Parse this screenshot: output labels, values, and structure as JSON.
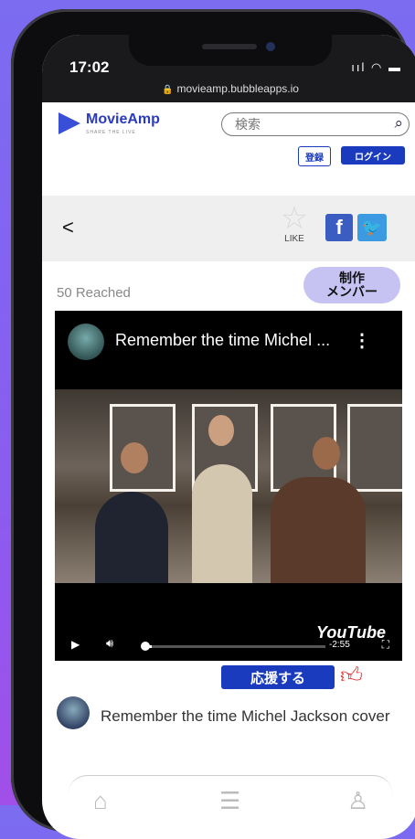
{
  "status": {
    "time": "17:02",
    "signal": "ııl",
    "wifi": "wifi",
    "battery": "battery"
  },
  "browser": {
    "url": "movieamp.bubbleapps.io"
  },
  "header": {
    "logo_text": "MovieAmp",
    "logo_tagline": "SHARE THE LIVE",
    "search_placeholder": "検索",
    "register_label": "登録",
    "login_label": "ログイン"
  },
  "actions": {
    "back": "<",
    "like_label": "LIKE",
    "facebook": "f",
    "twitter": "🐦"
  },
  "reach": {
    "text": "50 Reached"
  },
  "members_button": {
    "label": "制作\nメンバー"
  },
  "video": {
    "title": "Remember the time Michel ...",
    "menu": "⋮",
    "platform": "YouTube",
    "duration": "-2:55",
    "progress": 0.05
  },
  "support_button": {
    "label": "応援する"
  },
  "post": {
    "title": "Remember the time Michel Jackson cover"
  },
  "tabs": [
    {
      "name": "home-icon",
      "glyph": "⌂"
    },
    {
      "name": "list-icon",
      "glyph": "☰"
    },
    {
      "name": "user-icon",
      "glyph": "♙"
    }
  ],
  "colors": {
    "brand": "#1a3bbd",
    "members_bg": "#c6c3f2",
    "thumb": "#e53b3b"
  }
}
